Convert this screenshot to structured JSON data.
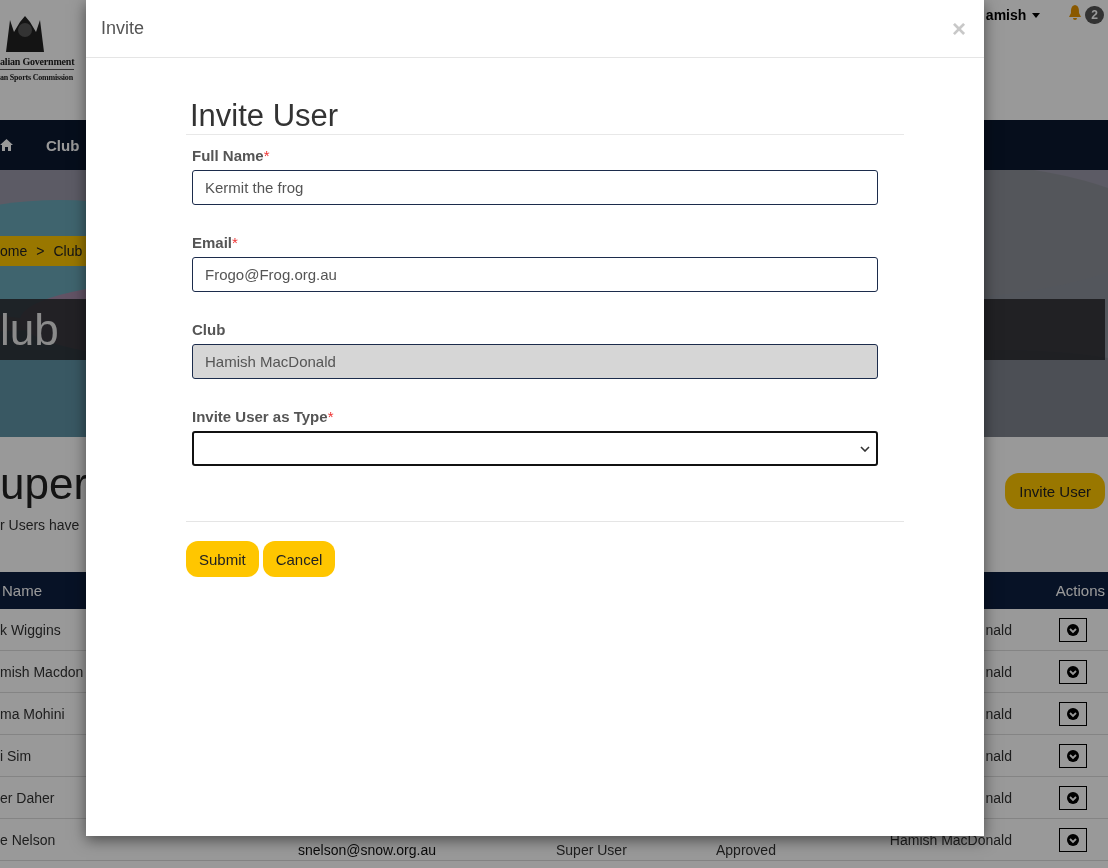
{
  "header": {
    "logo_lines": [
      "alian Government",
      "an Sports Commission"
    ],
    "user_menu": "amish",
    "notification_count": "2"
  },
  "nav": {
    "items": [
      "Club"
    ]
  },
  "hero": {
    "breadcrumb": {
      "items": [
        "ome",
        "Club"
      ],
      "separator": ">"
    },
    "title": "lub"
  },
  "page": {
    "heading": "uper",
    "description": "r Users have",
    "invite_button": "Invite User"
  },
  "table": {
    "columns": [
      "Name",
      "Actions"
    ],
    "rows": [
      {
        "name": "k Wiggins",
        "club": "nald"
      },
      {
        "name": "mish Macdon",
        "club": "nald"
      },
      {
        "name": "ma Mohini",
        "club": "nald"
      },
      {
        "name": "i Sim",
        "club": "nald"
      },
      {
        "name": "er Daher",
        "club": "nald"
      },
      {
        "name": "e Nelson",
        "email": "snelson@snow.org.au",
        "user_type": "Super User",
        "status": "Approved",
        "club": "Hamish MacDonald"
      }
    ]
  },
  "modal": {
    "title": "Invite",
    "close": "×",
    "heading": "Invite User",
    "fields": [
      {
        "kind": "text",
        "label": "Full Name",
        "required_mark": "*",
        "value": "Kermit the frog",
        "disabled": false,
        "focused": false
      },
      {
        "kind": "text",
        "label": "Email",
        "required_mark": "*",
        "value": "Frogo@Frog.org.au",
        "disabled": false,
        "focused": false
      },
      {
        "kind": "text",
        "label": "Club",
        "value": "Hamish MacDonald",
        "disabled": true,
        "focused": false
      },
      {
        "kind": "select",
        "label": "Invite User as Type",
        "required_mark": "*",
        "disabled": false,
        "focused": true
      }
    ],
    "buttons": [
      "Submit",
      "Cancel"
    ]
  }
}
